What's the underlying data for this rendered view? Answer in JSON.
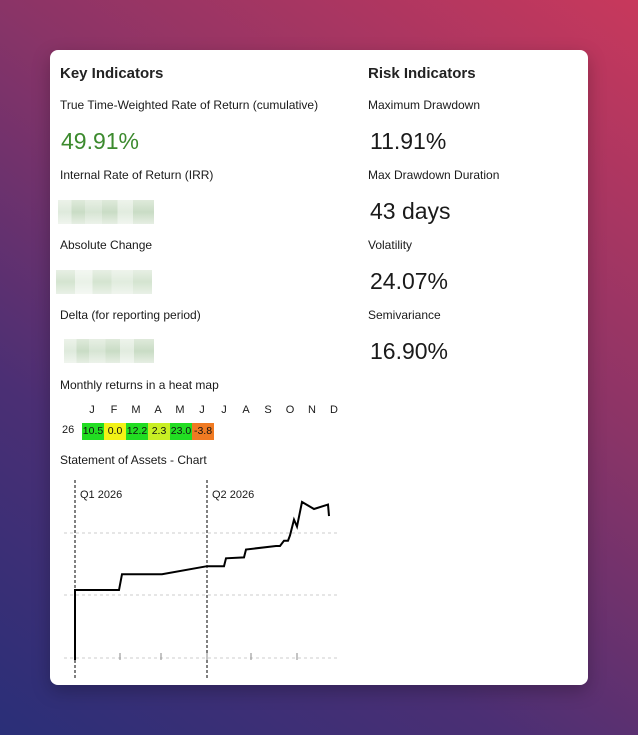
{
  "key_indicators": {
    "title": "Key Indicators",
    "ttwror_label": "True Time-Weighted Rate of Return (cumulative)",
    "ttwror_value": "49.91%",
    "irr_label": "Internal Rate of Return (IRR)",
    "abs_change_label": "Absolute Change",
    "delta_label": "Delta (for reporting period)"
  },
  "risk_indicators": {
    "title": "Risk Indicators",
    "items": [
      {
        "label": "Maximum Drawdown",
        "value": "11.91%"
      },
      {
        "label": "Max Drawdown Duration",
        "value": "43 days"
      },
      {
        "label": "Volatility",
        "value": "24.07%"
      },
      {
        "label": "Semivariance",
        "value": "16.90%"
      }
    ]
  },
  "heatmap": {
    "title": "Monthly returns in a heat map",
    "months": [
      "J",
      "F",
      "M",
      "A",
      "M",
      "J",
      "J",
      "A",
      "S",
      "O",
      "N",
      "D"
    ],
    "year": "26",
    "cells": [
      {
        "value": "10.5",
        "color": "#22dd22"
      },
      {
        "value": "0.0",
        "color": "#f2f216"
      },
      {
        "value": "12.2",
        "color": "#22dd22"
      },
      {
        "value": "2.3",
        "color": "#c8ef24"
      },
      {
        "value": "23.0",
        "color": "#22dd22"
      },
      {
        "value": "-3.8",
        "color": "#f07a22"
      }
    ]
  },
  "assets_chart": {
    "title": "Statement of Assets - Chart"
  },
  "chart_data": {
    "type": "line",
    "title": "Statement of Assets - Chart",
    "period_labels": [
      "Q1 2026",
      "Q2 2026"
    ],
    "x_start": "2026-01-01",
    "x_end": "2026-06-30",
    "y_values_relative": [
      0.0,
      0.0,
      0.0,
      0.18,
      0.18,
      0.18,
      0.27,
      0.27,
      0.36,
      0.37,
      0.46,
      0.5,
      0.5,
      0.56,
      0.56,
      0.62,
      0.8,
      0.72,
      1.0,
      0.92,
      0.97,
      0.84
    ],
    "grid": true
  }
}
